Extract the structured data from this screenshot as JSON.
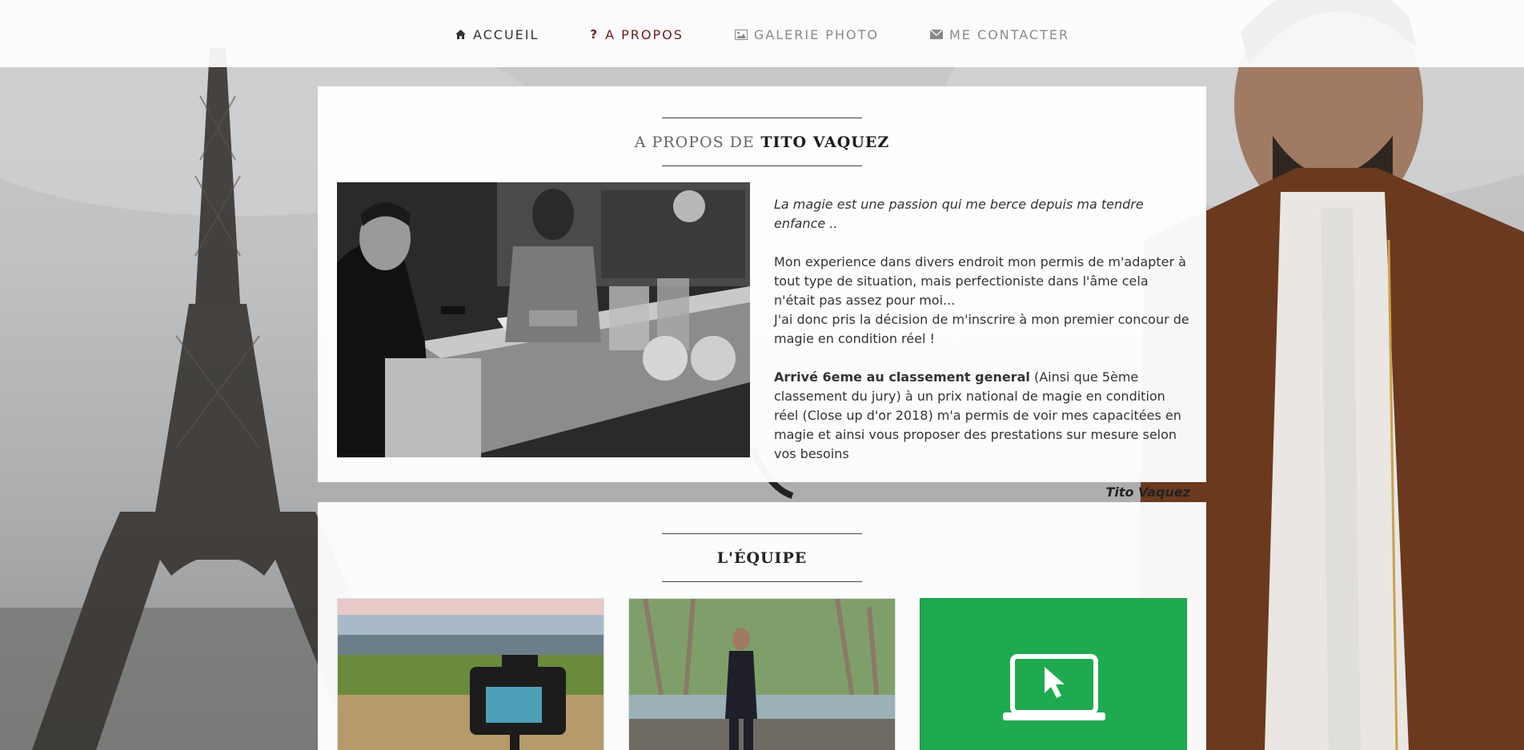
{
  "nav": {
    "items": [
      {
        "label": "Accueil",
        "icon": "home-icon"
      },
      {
        "label": "A propos",
        "icon": "question-icon"
      },
      {
        "label": "Galerie photo",
        "icon": "image-icon"
      },
      {
        "label": "Me contacter",
        "icon": "envelope-icon"
      }
    ],
    "active_label": "A propos"
  },
  "about": {
    "heading_light": "A propos de",
    "heading_strong": "Tito Vaquez",
    "intro": "La magie est une passion qui me berce depuis ma tendre enfance ..",
    "paragraph_1": "Mon experience dans divers endroit mon permis de m'adapter à tout type de situation, mais perfectioniste dans l'âme cela n'était pas assez pour moi...",
    "paragraph_2": "J'ai donc pris la décision de m'inscrire à mon premier concour de magie en condition réel !",
    "paragraph_3_bold": "Arrivé 6eme au classement general",
    "paragraph_3_rest": " (Ainsi que 5ème classement du jury) à un prix national de magie en condition réel (Close up d'or 2018) m'a permis de voir mes capacitées en magie et ainsi vous proposer des prestations sur mesure selon vos besoins",
    "signature": "Tito Vaquez"
  },
  "team": {
    "heading": "L'équipe"
  },
  "colors": {
    "active_nav": "#6b1b1b",
    "card_green": "#1faa4f"
  }
}
